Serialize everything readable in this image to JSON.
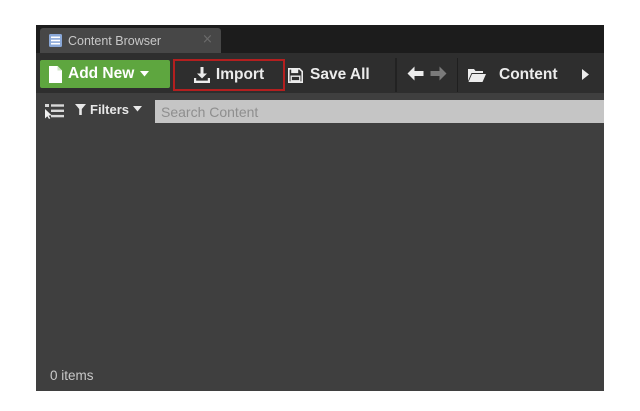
{
  "window": {
    "tab_title": "Content Browser",
    "tab_close": "×",
    "tab_icon": "content-browser-icon"
  },
  "toolbar": {
    "add_new_label": "Add New",
    "import_label": "Import",
    "save_all_label": "Save All",
    "content_label": "Content",
    "icons": [
      "new-file-icon",
      "import-download-icon",
      "save-icon",
      "back-arrow-icon",
      "forward-arrow-icon",
      "folder-icon",
      "path-arrow-icon"
    ]
  },
  "filter_bar": {
    "filters_label": "Filters",
    "search_placeholder": "Search Content"
  },
  "status": {
    "item_count": "0 items"
  },
  "colors": {
    "add_new_green": "#5ea63f",
    "import_highlight": "#b31f1f",
    "panel_bg": "#3f3f3f",
    "toolbar_bg": "#2e2e2e"
  }
}
